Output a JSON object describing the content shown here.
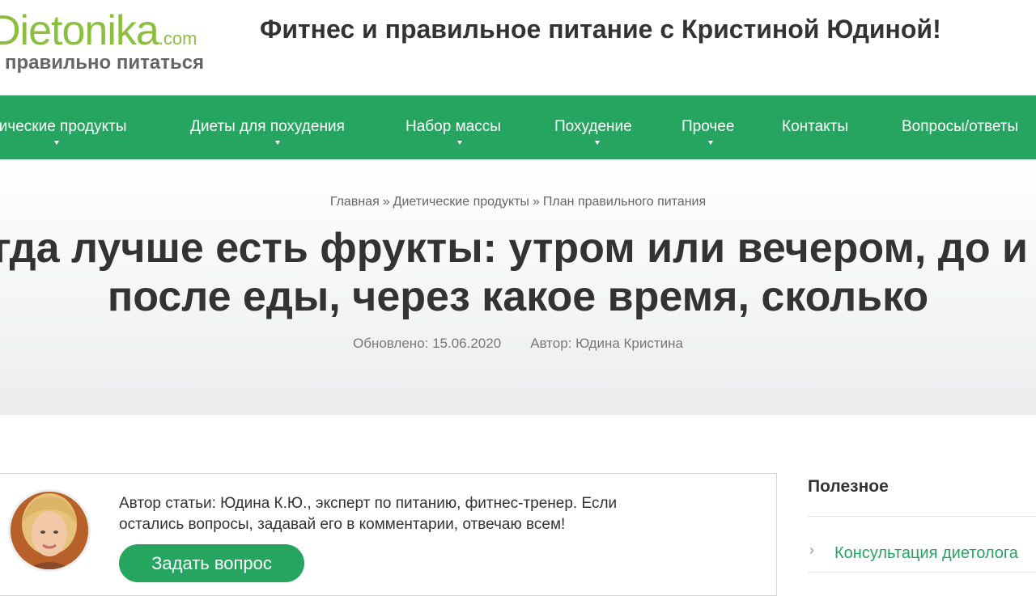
{
  "header": {
    "logo_main": "Dietonika",
    "logo_suffix": ".com",
    "logo_tagline": "а правильно питаться",
    "site_title": "Фитнес и правильное питание с Кристиной Юдиной!"
  },
  "nav": {
    "items": [
      {
        "label": "тические продукты",
        "has_dropdown": true
      },
      {
        "label": "Диеты для похудения",
        "has_dropdown": true
      },
      {
        "label": "Набор массы",
        "has_dropdown": true
      },
      {
        "label": "Похудение",
        "has_dropdown": true
      },
      {
        "label": "Прочее",
        "has_dropdown": true
      },
      {
        "label": "Контакты",
        "has_dropdown": false
      },
      {
        "label": "Вопросы/ответы",
        "has_dropdown": false
      }
    ]
  },
  "breadcrumb": {
    "items": [
      "Главная",
      "Диетические продукты",
      "План правильного питания"
    ],
    "separator": "»"
  },
  "article": {
    "title_line1": "гда лучше есть фрукты: утром или вечером, до и",
    "title_line2": "после еды, через какое время, сколько",
    "updated": "Обновлено: 15.06.2020",
    "author": "Автор: Юдина Кристина"
  },
  "author_box": {
    "text": "Автор статьи: Юдина К.Ю., эксперт по питанию, фитнес-тренер. Если остались вопросы, задавай его в комментарии, отвечаю всем!",
    "button": "Задать вопрос"
  },
  "sidebar": {
    "title": "Полезное",
    "links": [
      "Консультация диетолога"
    ]
  },
  "colors": {
    "brand_green": "#25a55f",
    "logo_green": "#8cbf3f"
  }
}
